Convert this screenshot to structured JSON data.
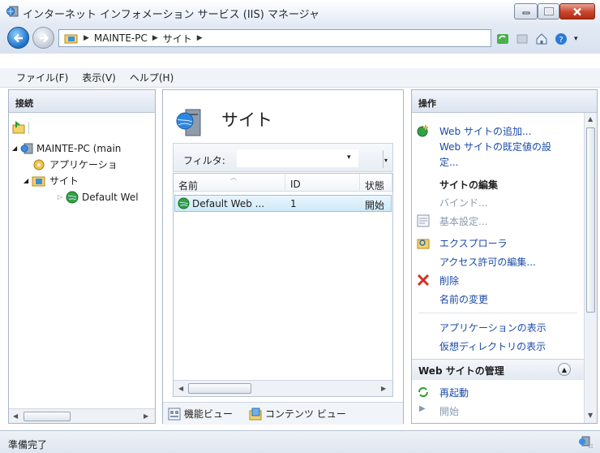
{
  "window": {
    "title": "インターネット インフォメーション サービス (IIS) マネージャ"
  },
  "address": {
    "crumbs": [
      "MAINTE-PC",
      "サイト"
    ]
  },
  "menu": [
    "ファイル(F)",
    "表示(V)",
    "ヘルプ(H)"
  ],
  "left": {
    "header": "接続",
    "tree": [
      {
        "label": "MAINTE-PC (main"
      },
      {
        "label": "アプリケーショ"
      },
      {
        "label": "サイト"
      },
      {
        "label": "Default Wel"
      }
    ]
  },
  "center": {
    "title": "サイト",
    "filter_label": "フィルタ:",
    "columns": [
      "名前",
      "ID",
      "状態"
    ],
    "rows": [
      {
        "name": "Default Web ...",
        "id": "1",
        "status": "開始"
      }
    ],
    "tabs": [
      "機能ビュー",
      "コンテンツ ビュー"
    ]
  },
  "right": {
    "header": "操作",
    "actions": {
      "add_site": "Web サイトの追加...",
      "site_defaults": "Web サイトの既定値の設",
      "site_defaults_2": "定...",
      "edit_site_heading": "サイトの編集",
      "bindings": "バインド...",
      "basic_settings": "基本設定...",
      "explore": "エクスプローラ",
      "edit_permissions": "アクセス許可の編集...",
      "delete": "削除",
      "rename": "名前の変更",
      "view_apps": "アプリケーションの表示",
      "view_vdirs": "仮想ディレクトリの表示",
      "manage_heading": "Web サイトの管理",
      "restart": "再起動",
      "start": "開始"
    }
  },
  "status": {
    "text": "準備完了"
  },
  "colors": {
    "link": "#1a4aa8",
    "disabled": "#8a99b0",
    "selection": "#cde9f8",
    "delete_x": "#d03020"
  }
}
